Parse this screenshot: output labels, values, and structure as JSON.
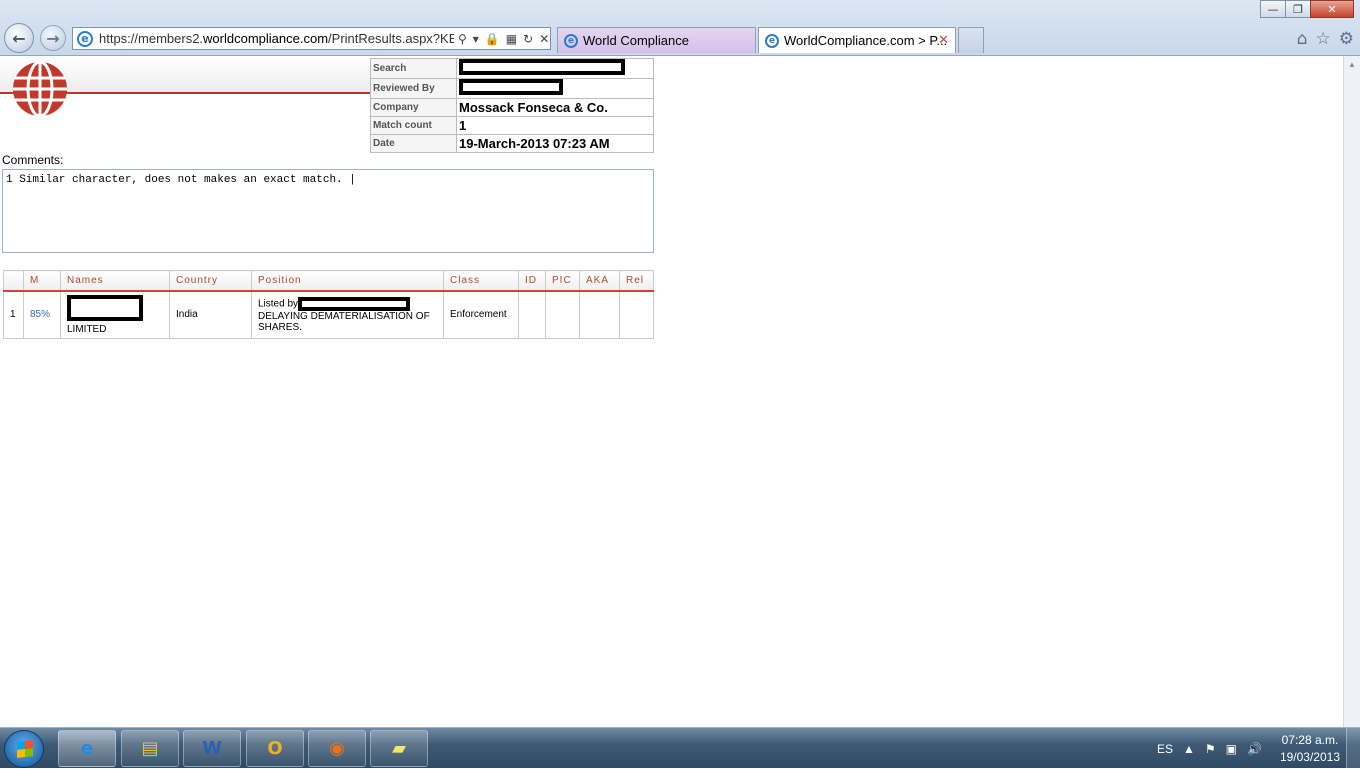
{
  "window": {
    "minimize": "—",
    "restore": "❐",
    "close": "✕"
  },
  "browser": {
    "back": "←",
    "forward": "→",
    "url_prefix": "https://members2.",
    "url_domain": "worldcompliance.com",
    "url_suffix": "/PrintResults.aspx?KEYP=",
    "tabs": [
      {
        "label": "World Compliance"
      },
      {
        "label": "WorldCompliance.com > P..."
      }
    ]
  },
  "report": {
    "info": [
      {
        "label": "Search",
        "value": ""
      },
      {
        "label": "Reviewed By",
        "value": ""
      },
      {
        "label": "Company",
        "value": "Mossack Fonseca & Co."
      },
      {
        "label": "Match count",
        "value": "1"
      },
      {
        "label": "Date",
        "value": "19-March-2013 07:23 AM"
      }
    ],
    "comments_label": "Comments:",
    "comments_text": "1 Similar character, does not makes an exact match. |",
    "columns": [
      "",
      "M",
      "Names",
      "Country",
      "Position",
      "Class",
      "ID",
      "PIC",
      "AKA",
      "Rel"
    ],
    "rows": [
      {
        "index": "1",
        "match": "85%",
        "name": "LIMITED",
        "country": "India",
        "position_prefix": "Listed by",
        "position_rest": "DELAYING DEMATERIALISATION OF SHARES.",
        "class": "Enforcement",
        "id": "",
        "pic": "",
        "aka": "",
        "rel": ""
      }
    ]
  },
  "taskbar": {
    "language": "ES",
    "time": "07:28 a.m.",
    "date": "19/03/2013"
  },
  "colors": {
    "accent_red": "#b8362a",
    "match_blue": "#2a6ec4"
  }
}
